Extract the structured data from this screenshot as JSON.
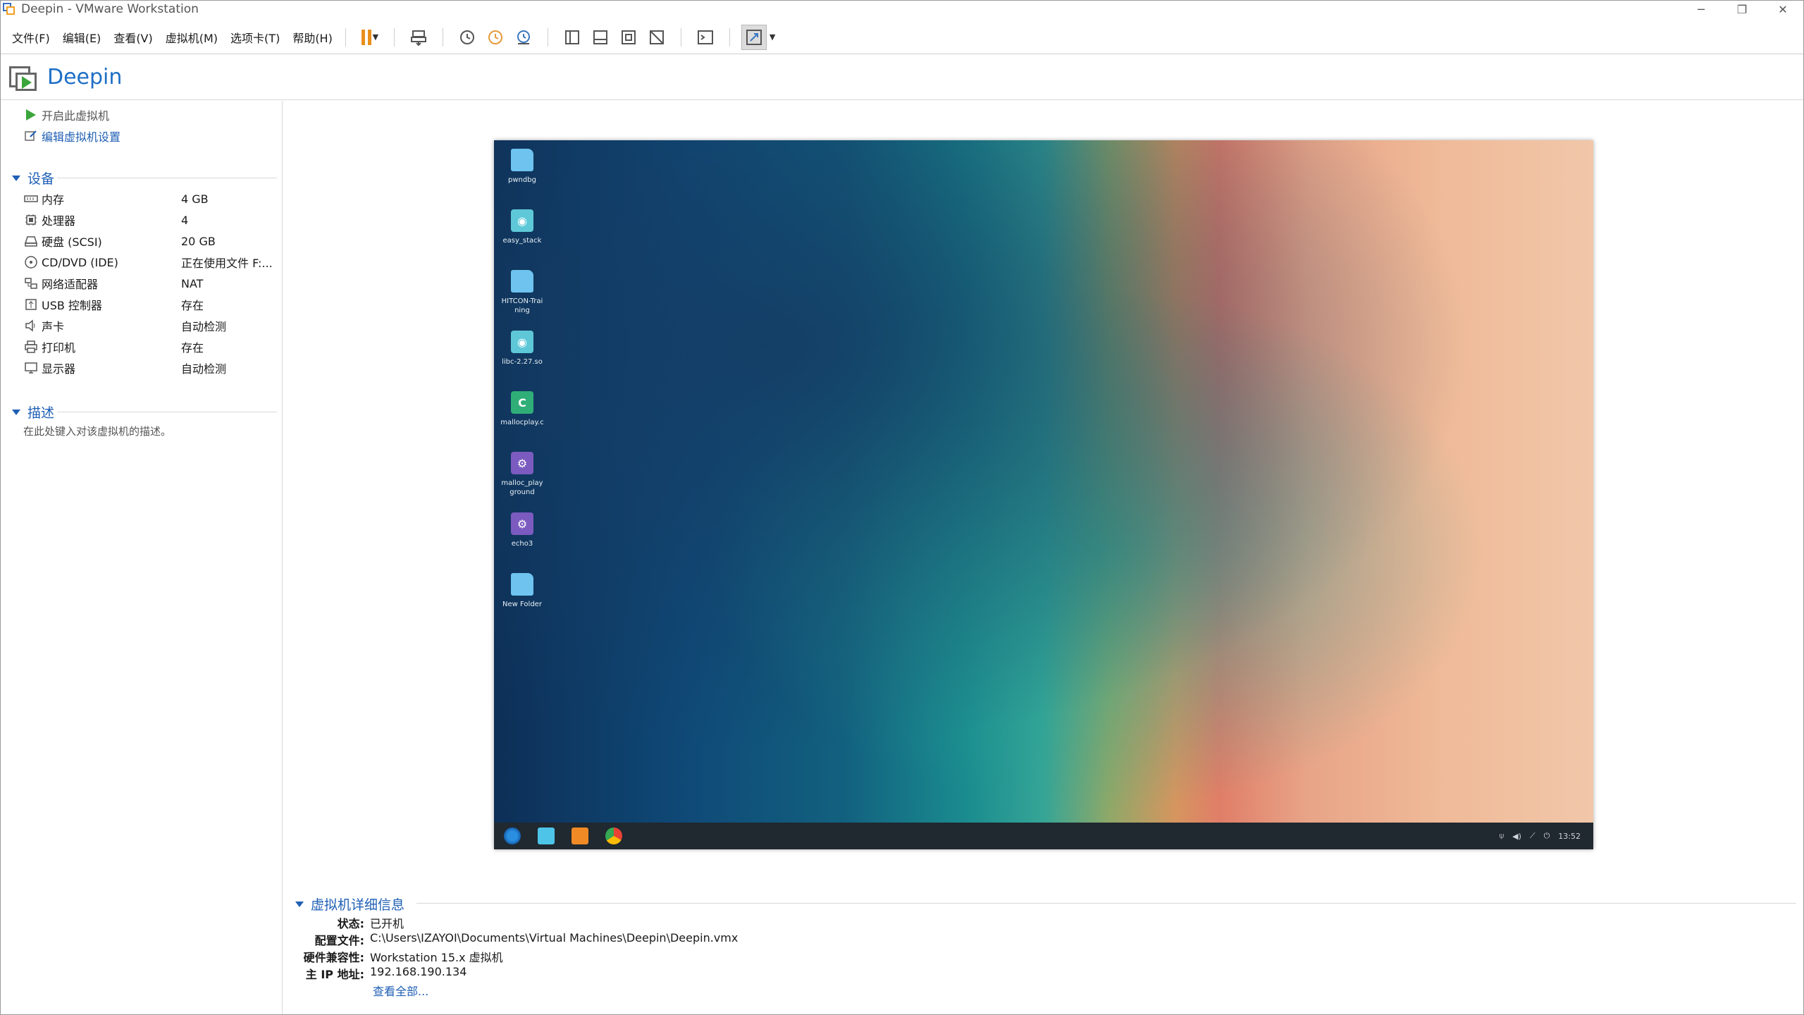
{
  "window": {
    "title": "Deepin - VMware Workstation",
    "controls": {
      "minimize": "─",
      "restore": "❐",
      "close": "✕"
    }
  },
  "menu": [
    "文件(F)",
    "编辑(E)",
    "查看(V)",
    "虚拟机(M)",
    "选项卡(T)",
    "帮助(H)"
  ],
  "vm": {
    "name": "Deepin"
  },
  "actions": {
    "start": "开启此虚拟机",
    "edit": "编辑虚拟机设置"
  },
  "devices": {
    "title": "设备",
    "items": [
      {
        "name": "内存",
        "value": "4 GB",
        "icon": "memory-icon"
      },
      {
        "name": "处理器",
        "value": "4",
        "icon": "cpu-icon"
      },
      {
        "name": "硬盘 (SCSI)",
        "value": "20 GB",
        "icon": "hard-disk-icon"
      },
      {
        "name": "CD/DVD (IDE)",
        "value": "正在使用文件 F:...",
        "icon": "cd-dvd-icon"
      },
      {
        "name": "网络适配器",
        "value": "NAT",
        "icon": "network-icon"
      },
      {
        "name": "USB 控制器",
        "value": "存在",
        "icon": "usb-icon"
      },
      {
        "name": "声卡",
        "value": "自动检测",
        "icon": "sound-icon"
      },
      {
        "name": "打印机",
        "value": "存在",
        "icon": "printer-icon"
      },
      {
        "name": "显示器",
        "value": "自动检测",
        "icon": "monitor-icon"
      }
    ]
  },
  "description": {
    "title": "描述",
    "placeholder": "在此处键入对该虚拟机的描述。"
  },
  "desktop": {
    "icons": [
      {
        "label": "pwndbg",
        "type": "folder"
      },
      {
        "label": "easy_stack",
        "type": "file"
      },
      {
        "label": "HITCON-Training",
        "type": "folder"
      },
      {
        "label": "libc-2.27.so",
        "type": "file"
      },
      {
        "label": "mallocplay.c",
        "type": "c-file"
      },
      {
        "label": "malloc_playground",
        "type": "exe"
      },
      {
        "label": "echo3",
        "type": "exe"
      },
      {
        "label": "New Folder",
        "type": "folder"
      }
    ],
    "clock": "13:52"
  },
  "details": {
    "title": "虚拟机详细信息",
    "rows": [
      {
        "key": "状态:",
        "value": "已开机"
      },
      {
        "key": "配置文件:",
        "value": "C:\\Users\\IZAYOI\\Documents\\Virtual Machines\\Deepin\\Deepin.vmx"
      },
      {
        "key": "硬件兼容性:",
        "value": "Workstation 15.x 虚拟机"
      },
      {
        "key": "主 IP 地址:",
        "value": "192.168.190.134"
      }
    ],
    "see_all": "查看全部..."
  },
  "colors": {
    "accent": "#1f5fb5",
    "pause": "#e8901b",
    "play": "#3ba53b"
  }
}
